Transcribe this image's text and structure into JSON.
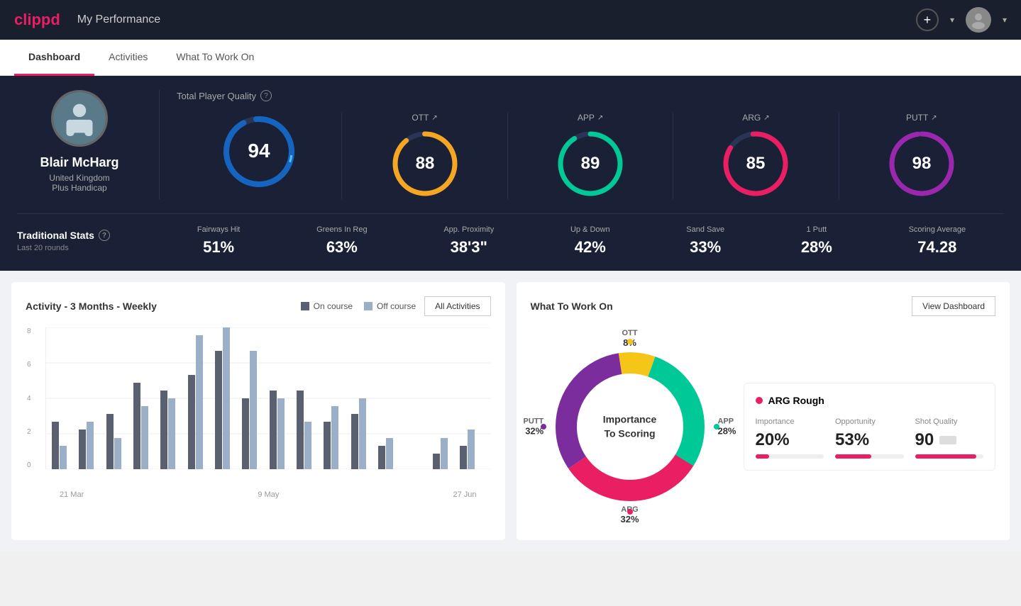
{
  "header": {
    "logo": "clippd",
    "title": "My Performance",
    "add_icon": "+",
    "dropdown_arrow": "▾"
  },
  "tabs": [
    {
      "label": "Dashboard",
      "active": true
    },
    {
      "label": "Activities",
      "active": false
    },
    {
      "label": "What To Work On",
      "active": false
    }
  ],
  "player": {
    "name": "Blair McHarg",
    "country": "United Kingdom",
    "handicap": "Plus Handicap"
  },
  "quality": {
    "title": "Total Player Quality",
    "main": {
      "value": "94"
    },
    "categories": [
      {
        "label": "OTT",
        "value": "88",
        "color": "#f5a623"
      },
      {
        "label": "APP",
        "value": "89",
        "color": "#00c896"
      },
      {
        "label": "ARG",
        "value": "85",
        "color": "#e91e63"
      },
      {
        "label": "PUTT",
        "value": "98",
        "color": "#9b27af"
      }
    ]
  },
  "trad_stats": {
    "title": "Traditional Stats",
    "subtitle": "Last 20 rounds",
    "items": [
      {
        "label": "Fairways Hit",
        "value": "51%"
      },
      {
        "label": "Greens In Reg",
        "value": "63%"
      },
      {
        "label": "App. Proximity",
        "value": "38'3\""
      },
      {
        "label": "Up & Down",
        "value": "42%"
      },
      {
        "label": "Sand Save",
        "value": "33%"
      },
      {
        "label": "1 Putt",
        "value": "28%"
      },
      {
        "label": "Scoring Average",
        "value": "74.28"
      }
    ]
  },
  "activity_chart": {
    "title": "Activity - 3 Months - Weekly",
    "legend": {
      "oncourse": "On course",
      "offcourse": "Off course"
    },
    "all_activities_btn": "All Activities",
    "y_labels": [
      "0",
      "2",
      "4",
      "6",
      "8"
    ],
    "x_labels": [
      "21 Mar",
      "9 May",
      "27 Jun"
    ],
    "bars": [
      {
        "on": 30,
        "off": 15
      },
      {
        "on": 25,
        "off": 30
      },
      {
        "on": 35,
        "off": 20
      },
      {
        "on": 55,
        "off": 40
      },
      {
        "on": 50,
        "off": 45
      },
      {
        "on": 60,
        "off": 85
      },
      {
        "on": 75,
        "off": 90
      },
      {
        "on": 45,
        "off": 75
      },
      {
        "on": 50,
        "off": 45
      },
      {
        "on": 50,
        "off": 30
      },
      {
        "on": 30,
        "off": 40
      },
      {
        "on": 35,
        "off": 45
      },
      {
        "on": 15,
        "off": 20
      },
      {
        "on": 0,
        "off": 0
      },
      {
        "on": 10,
        "off": 20
      },
      {
        "on": 15,
        "off": 25
      }
    ]
  },
  "work_on": {
    "title": "What To Work On",
    "view_btn": "View Dashboard",
    "center_label": "Importance\nTo Scoring",
    "segments": [
      {
        "label": "OTT",
        "value": "8%",
        "color": "#f5c518",
        "position": "top"
      },
      {
        "label": "APP",
        "value": "28%",
        "color": "#00c896",
        "position": "right"
      },
      {
        "label": "ARG",
        "value": "32%",
        "color": "#e91e63",
        "position": "bottom"
      },
      {
        "label": "PUTT",
        "value": "32%",
        "color": "#7b2d9e",
        "position": "left"
      }
    ],
    "detail_card": {
      "title": "ARG Rough",
      "dot_color": "#e91e63",
      "stats": [
        {
          "label": "Importance",
          "value": "20%",
          "fill": 20
        },
        {
          "label": "Opportunity",
          "value": "53%",
          "fill": 53
        },
        {
          "label": "Shot Quality",
          "value": "90",
          "fill": 90
        }
      ]
    }
  }
}
